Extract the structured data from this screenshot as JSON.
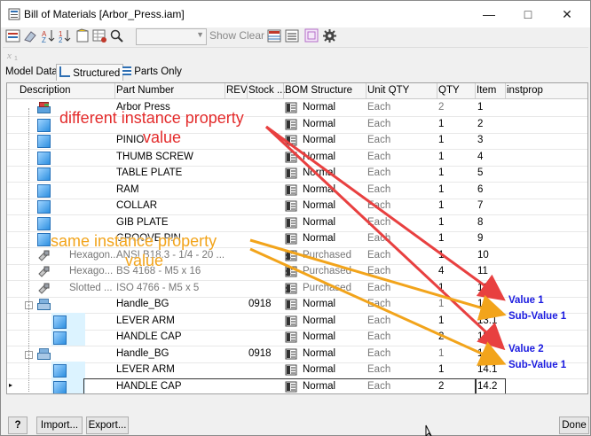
{
  "window": {
    "title": "Bill of Materials [Arbor_Press.iam]"
  },
  "toolbar": {
    "show_clear": "Show Clear"
  },
  "tabs": [
    "Model Data",
    "Structured",
    "Parts Only"
  ],
  "columns": [
    "Description",
    "Part Number",
    "REV",
    "Stock ...",
    "BOM Structure",
    "Unit QTY",
    "QTY",
    "Item",
    "instprop"
  ],
  "rows": [
    {
      "desc": "",
      "part": "Arbor Press",
      "rev": "",
      "stock": "",
      "bom": "Normal",
      "unit": "Each",
      "qty": "2",
      "item": "1"
    },
    {
      "desc": "",
      "part": "",
      "rev": "",
      "stock": "",
      "bom": "Normal",
      "unit": "Each",
      "qty": "1",
      "item": "2"
    },
    {
      "desc": "",
      "part": "PINIO",
      "rev": "",
      "stock": "",
      "bom": "Normal",
      "unit": "Each",
      "qty": "1",
      "item": "3"
    },
    {
      "desc": "",
      "part": "THUMB SCREW",
      "rev": "",
      "stock": "",
      "bom": "Normal",
      "unit": "Each",
      "qty": "1",
      "item": "4"
    },
    {
      "desc": "",
      "part": "TABLE PLATE",
      "rev": "",
      "stock": "",
      "bom": "Normal",
      "unit": "Each",
      "qty": "1",
      "item": "5"
    },
    {
      "desc": "",
      "part": "RAM",
      "rev": "",
      "stock": "",
      "bom": "Normal",
      "unit": "Each",
      "qty": "1",
      "item": "6"
    },
    {
      "desc": "",
      "part": "COLLAR",
      "rev": "",
      "stock": "",
      "bom": "Normal",
      "unit": "Each",
      "qty": "1",
      "item": "7"
    },
    {
      "desc": "",
      "part": "GIB PLATE",
      "rev": "",
      "stock": "",
      "bom": "Normal",
      "unit": "Each",
      "qty": "1",
      "item": "8"
    },
    {
      "desc": "",
      "part": "GROOVE PIN",
      "rev": "",
      "stock": "",
      "bom": "Normal",
      "unit": "Each",
      "qty": "1",
      "item": "9"
    },
    {
      "desc": "Hexagon...",
      "part": "ANSI B18.3 - 1/4 - 20 ...",
      "rev": "",
      "stock": "",
      "bom": "Purchased",
      "unit": "Each",
      "qty": "1",
      "item": "10"
    },
    {
      "desc": "Hexago...",
      "part": "BS 4168 - M5 x 16",
      "rev": "",
      "stock": "",
      "bom": "Purchased",
      "unit": "Each",
      "qty": "4",
      "item": "11"
    },
    {
      "desc": "Slotted ...",
      "part": "ISO 4766 - M5 x 5",
      "rev": "",
      "stock": "",
      "bom": "Purchased",
      "unit": "Each",
      "qty": "1",
      "item": "12"
    },
    {
      "desc": "",
      "part": "Handle_BG",
      "rev": "",
      "stock": "0918",
      "bom": "Normal",
      "unit": "Each",
      "qty": "1",
      "item": "13"
    },
    {
      "desc": "",
      "part": "LEVER ARM",
      "rev": "",
      "stock": "",
      "bom": "Normal",
      "unit": "Each",
      "qty": "1",
      "item": "13.1"
    },
    {
      "desc": "",
      "part": "HANDLE CAP",
      "rev": "",
      "stock": "",
      "bom": "Normal",
      "unit": "Each",
      "qty": "2",
      "item": "13.2"
    },
    {
      "desc": "",
      "part": "Handle_BG",
      "rev": "",
      "stock": "0918",
      "bom": "Normal",
      "unit": "Each",
      "qty": "1",
      "item": "14"
    },
    {
      "desc": "",
      "part": "LEVER ARM",
      "rev": "",
      "stock": "",
      "bom": "Normal",
      "unit": "Each",
      "qty": "1",
      "item": "14.1"
    },
    {
      "desc": "",
      "part": "HANDLE CAP",
      "rev": "",
      "stock": "",
      "bom": "Normal",
      "unit": "Each",
      "qty": "2",
      "item": "14.2"
    }
  ],
  "annotations": {
    "red_line1": "different instance property",
    "red_line2": "value",
    "orange_line1": "same instance property",
    "orange_line2": "value",
    "value1": "Value 1",
    "subvalue1a": "Sub-Value 1",
    "value2": "Value 2",
    "subvalue1b": "Sub-Value 1"
  },
  "footer": {
    "help": "?",
    "import": "Import...",
    "export": "Export...",
    "done": "Done"
  },
  "colors": {
    "red_arrow": "#e84040",
    "orange_arrow": "#f2a41b",
    "value_text": "#1a1ae0"
  }
}
